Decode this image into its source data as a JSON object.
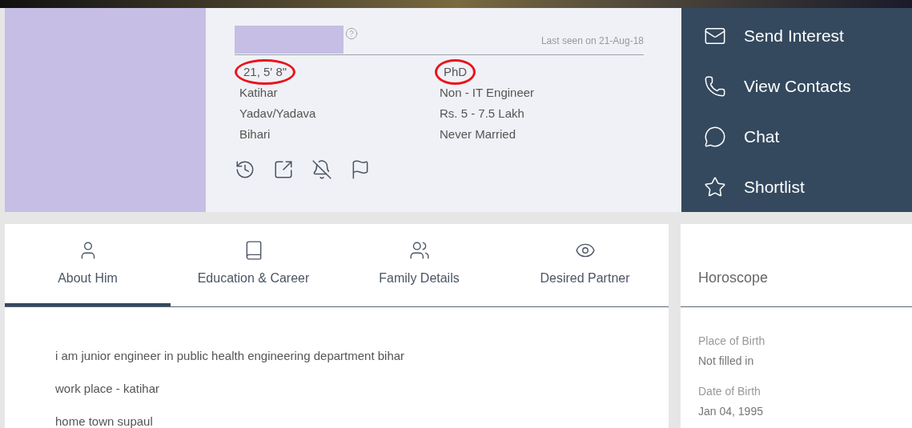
{
  "profile": {
    "last_seen": "Last seen on 21-Aug-18",
    "left_details": [
      {
        "text": "21, 5' 8\"",
        "circled": true
      },
      {
        "text": "Katihar",
        "circled": false
      },
      {
        "text": "Yadav/Yadava",
        "circled": false
      },
      {
        "text": "Bihari",
        "circled": false
      }
    ],
    "right_details": [
      {
        "text": "PhD",
        "circled": true
      },
      {
        "text": "Non - IT Engineer",
        "circled": false
      },
      {
        "text": "Rs. 5 - 7.5 Lakh",
        "circled": false
      },
      {
        "text": "Never Married",
        "circled": false
      }
    ],
    "tool_icons": [
      {
        "kind": "history"
      },
      {
        "kind": "share"
      },
      {
        "kind": "ignore"
      },
      {
        "kind": "flag"
      }
    ]
  },
  "actions": [
    {
      "kind": "interest",
      "label": "Send Interest"
    },
    {
      "kind": "contacts",
      "label": "View Contacts"
    },
    {
      "kind": "chat",
      "label": "Chat"
    },
    {
      "kind": "shortlist",
      "label": "Shortlist"
    }
  ],
  "tabs": [
    {
      "kind": "about",
      "label": "About Him",
      "selected": true
    },
    {
      "kind": "education",
      "label": "Education & Career",
      "selected": false
    },
    {
      "kind": "family",
      "label": "Family Details",
      "selected": false
    },
    {
      "kind": "partner",
      "label": "Desired Partner",
      "selected": false
    }
  ],
  "about": [
    "i am junior engineer in public health engineering department bihar",
    "work place - katihar",
    "home town supaul"
  ],
  "horoscope": {
    "title": "Horoscope",
    "fields": [
      {
        "label": "Place of Birth",
        "value": "Not filled in"
      },
      {
        "label": "Date of Birth",
        "value": "Jan 04, 1995"
      }
    ]
  }
}
